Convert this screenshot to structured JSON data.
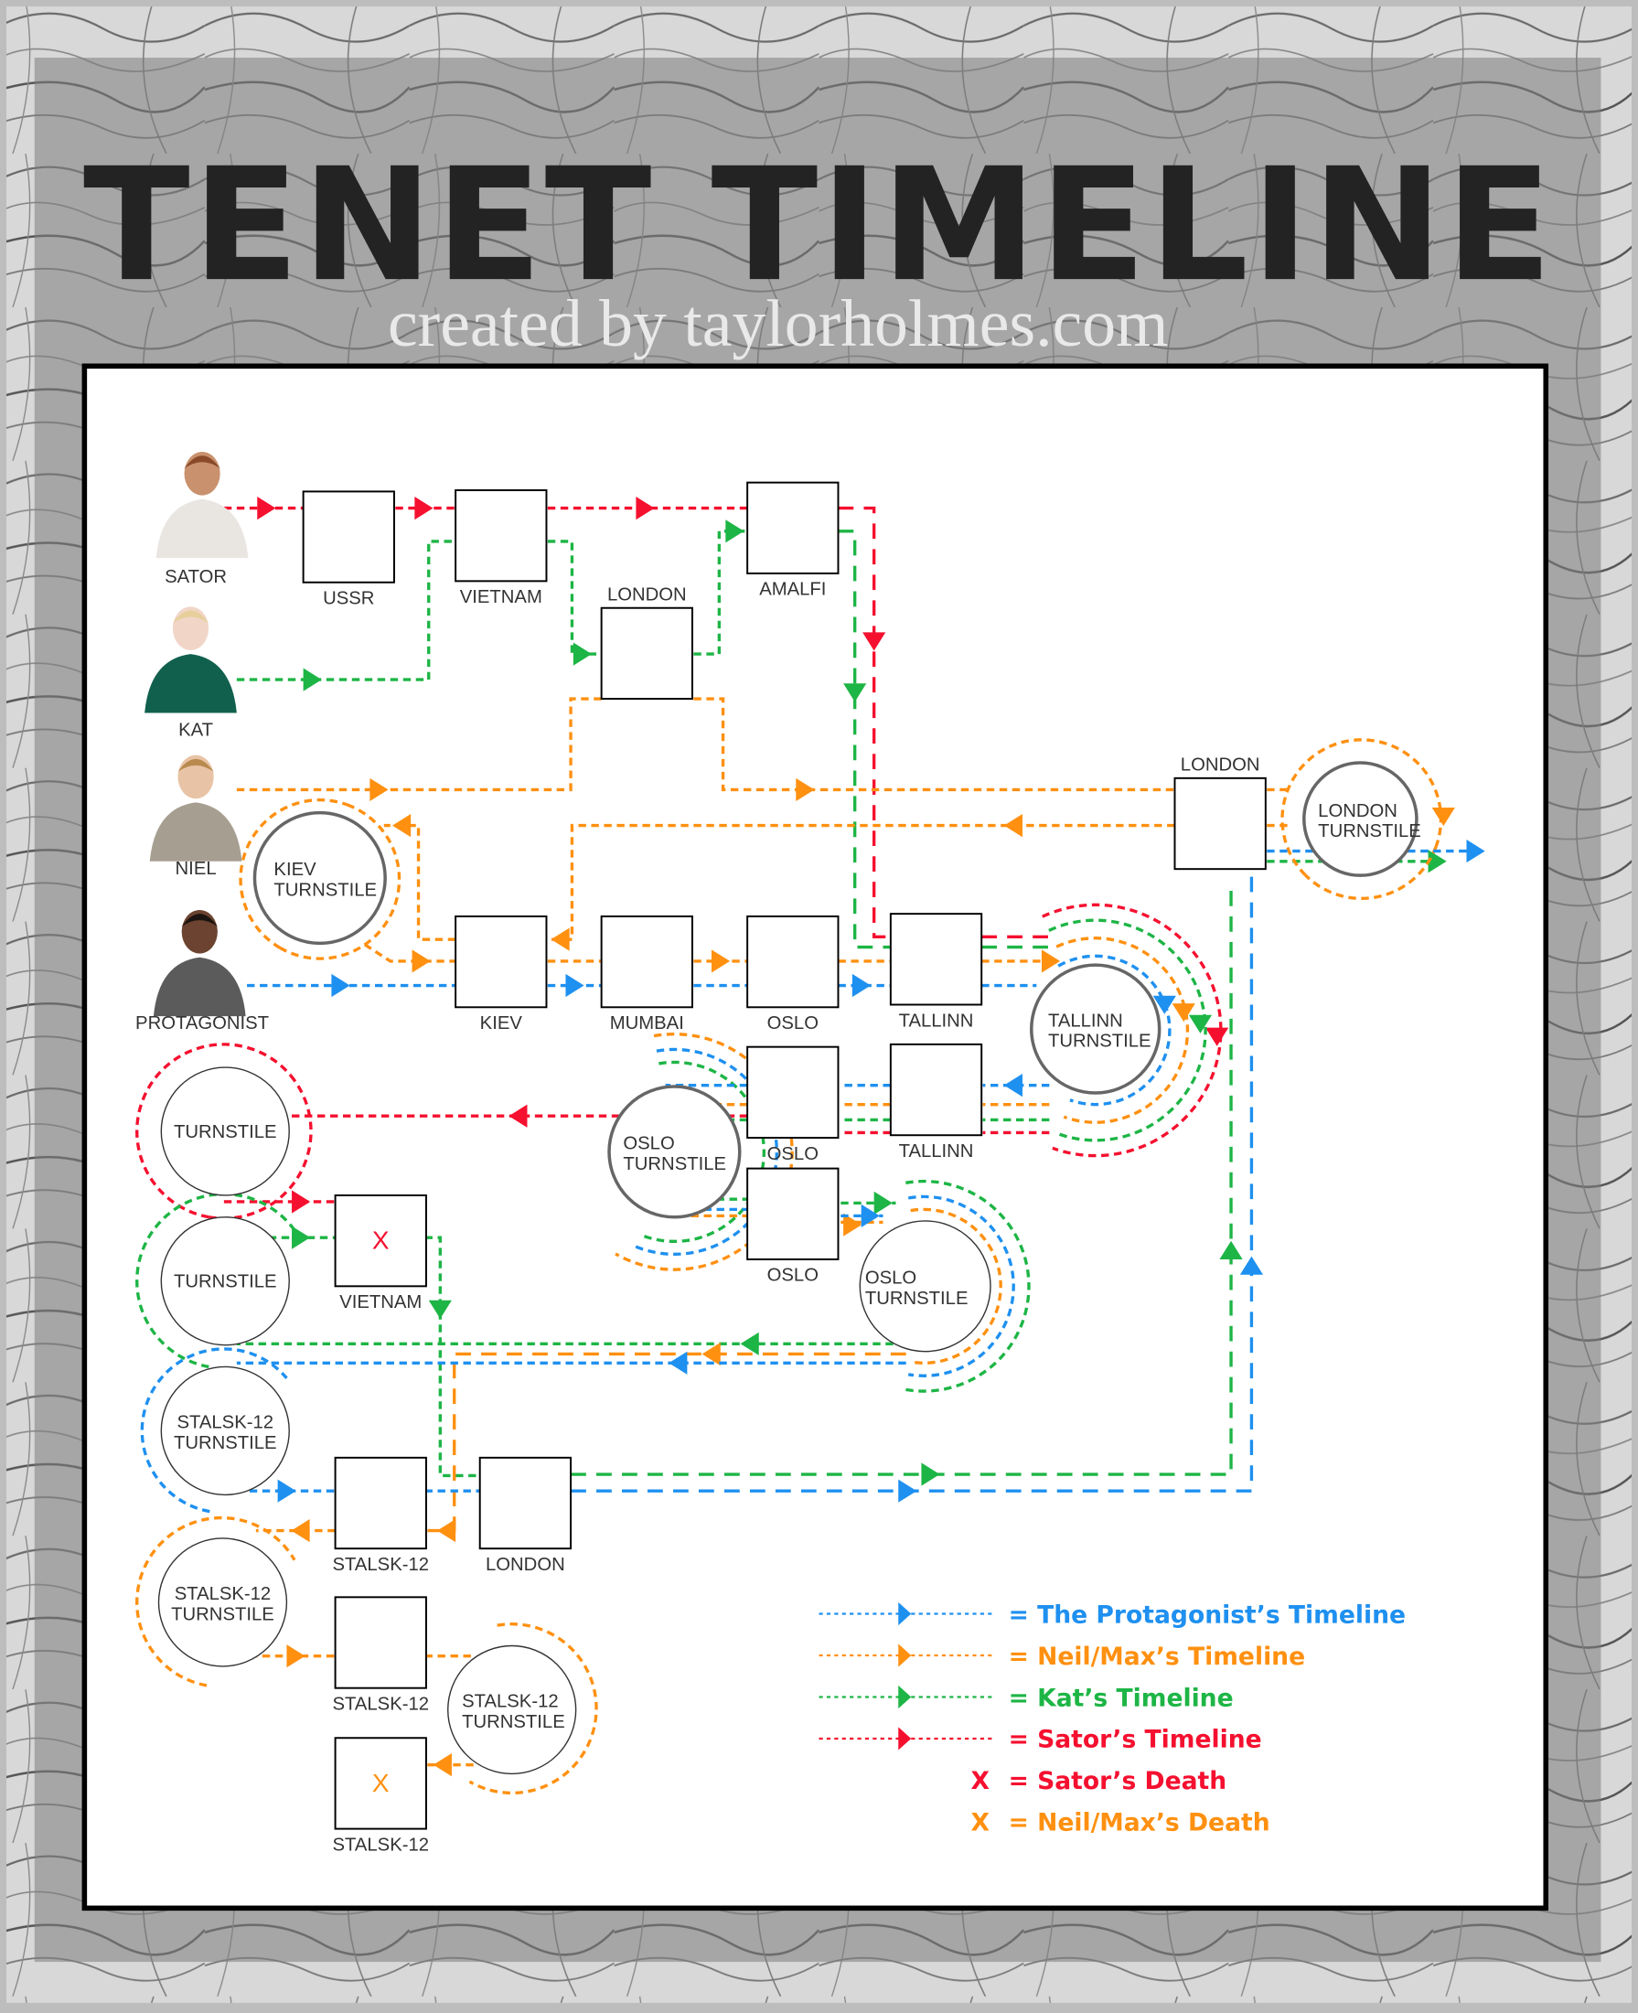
{
  "header": {
    "title": "TENET TIMELINE",
    "subtitle": "created by taylorholmes.com"
  },
  "colors": {
    "protagonist": "#1E90F0",
    "neil": "#FF9010",
    "kat": "#1DB545",
    "sator": "#F5102F"
  },
  "characters": [
    {
      "name": "SATOR"
    },
    {
      "name": "KAT"
    },
    {
      "name": "NIEL"
    },
    {
      "name": "PROTAGONIST"
    }
  ],
  "locations": [
    {
      "label": "USSR"
    },
    {
      "label": "VIETNAM"
    },
    {
      "label": "LONDON"
    },
    {
      "label": "AMALFI"
    },
    {
      "label": "LONDON"
    },
    {
      "label": "KIEV"
    },
    {
      "label": "MUMBAI"
    },
    {
      "label": "OSLO"
    },
    {
      "label": "TALLINN"
    },
    {
      "label": "OSLO"
    },
    {
      "label": "TALLINN"
    },
    {
      "label": "OSLO"
    },
    {
      "label": "VIETNAM",
      "mark": "X"
    },
    {
      "label": "STALSK-12"
    },
    {
      "label": "LONDON"
    },
    {
      "label": "STALSK-12"
    },
    {
      "label": "STALSK-12",
      "mark": "X"
    }
  ],
  "turnstiles": [
    {
      "line1": "LONDON",
      "line2": "TURNSTILE"
    },
    {
      "line1": "KIEV",
      "line2": "TURNSTILE"
    },
    {
      "line1": "TALLINN",
      "line2": "TURNSTILE"
    },
    {
      "line1": "TURNSTILE",
      "line2": ""
    },
    {
      "line1": "OSLO",
      "line2": "TURNSTILE"
    },
    {
      "line1": "TURNSTILE",
      "line2": ""
    },
    {
      "line1": "OSLO",
      "line2": "TURNSTILE"
    },
    {
      "line1": "STALSK-12",
      "line2": "TURNSTILE"
    },
    {
      "line1": "STALSK-12",
      "line2": "TURNSTILE"
    },
    {
      "line1": "STALSK-12",
      "line2": "TURNSTILE"
    }
  ],
  "legend": [
    {
      "text": "= The Protagonist’s Timeline",
      "color": "#1E90F0",
      "kind": "line"
    },
    {
      "text": "= Neil/Max’s Timeline",
      "color": "#FF9010",
      "kind": "line"
    },
    {
      "text": "= Kat’s Timeline",
      "color": "#1DB545",
      "kind": "line"
    },
    {
      "text": "= Sator’s Timeline",
      "color": "#F5102F",
      "kind": "line"
    },
    {
      "text": "= Sator’s Death",
      "color": "#F5102F",
      "kind": "x",
      "mark": "X"
    },
    {
      "text": "= Neil/Max’s Death",
      "color": "#FF9010",
      "kind": "x",
      "mark": "X"
    }
  ]
}
